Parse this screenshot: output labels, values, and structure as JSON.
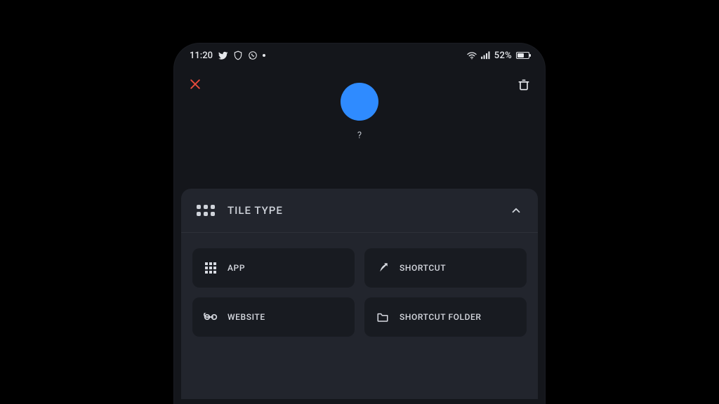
{
  "status_bar": {
    "time": "11:20",
    "battery_text": "52%"
  },
  "header": {
    "tile_label": "?"
  },
  "panel": {
    "title": "TILE TYPE",
    "options": {
      "app": "APP",
      "shortcut": "SHORTCUT",
      "website": "WEBSITE",
      "shortcut_folder": "SHORTCUT FOLDER"
    }
  }
}
